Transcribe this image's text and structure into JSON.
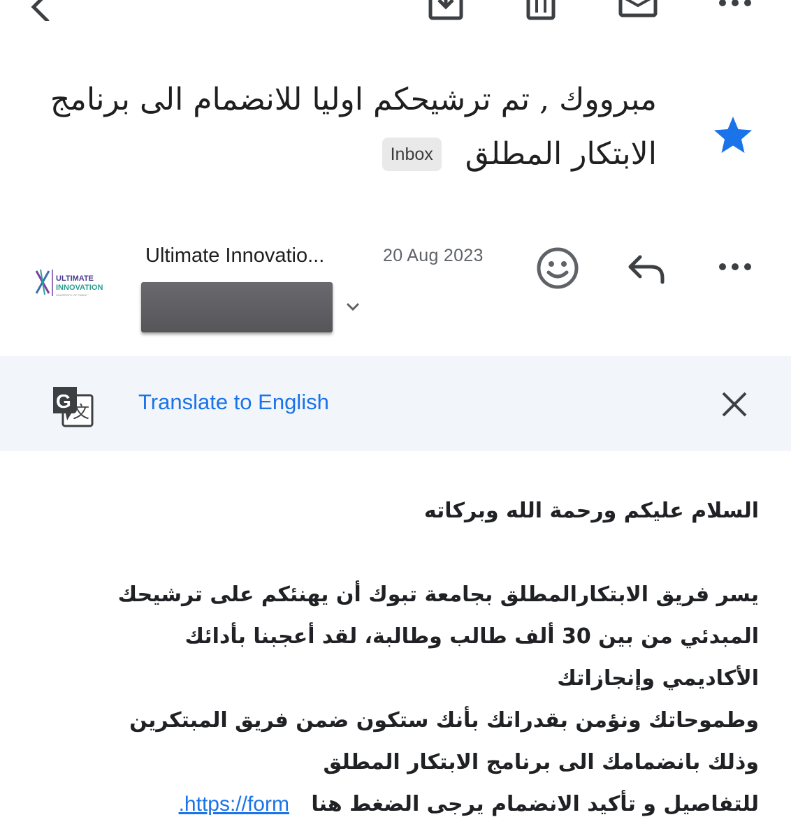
{
  "toolbar": {
    "icons": [
      "back-chevron-icon",
      "archive-icon",
      "trash-icon",
      "mark-unread-icon",
      "more-icon"
    ]
  },
  "email": {
    "subject_line1": "مبرووك , تم ترشيحكم اوليا للانضمام الى برنامج",
    "subject_line2": "الابتكار المطلق",
    "label": "Inbox",
    "starred": true,
    "sender_name": "Ultimate Innovatio...",
    "date": "20 Aug 2023",
    "logo_text_line1": "ULTIMATE",
    "logo_text_line2": "INNOVATION",
    "logo_subtext": "UNIVERSITY OF TABUK"
  },
  "translate": {
    "link_label": "Translate to English"
  },
  "body": {
    "greeting": "السلام عليكم ورحمة الله وبركاته",
    "p1_line1": "يسر فريق الابتكارالمطلق بجامعة تبوك أن يهنئكم على ترشيحك",
    "p1_line2": "المبدئي من بين 30 ألف طالب وطالبة، لقد أعجبنا بأدائك",
    "p1_line3": "الأكاديمي وإنجازاتك",
    "p1_line4": "وطموحاتك ونؤمن بقدراتك بأنك ستكون ضمن فريق المبتكرين",
    "p1_line5": "وذلك بانضمامك الى برنامج الابتكار المطلق",
    "p1_line6": "للتفاصيل و تأكيد الانضمام يرجى الضغط هنا",
    "link": "https://form."
  },
  "colors": {
    "accent_blue": "#1a73e8",
    "star_blue": "#1a73e8",
    "translate_bg": "#f2f5f9"
  }
}
